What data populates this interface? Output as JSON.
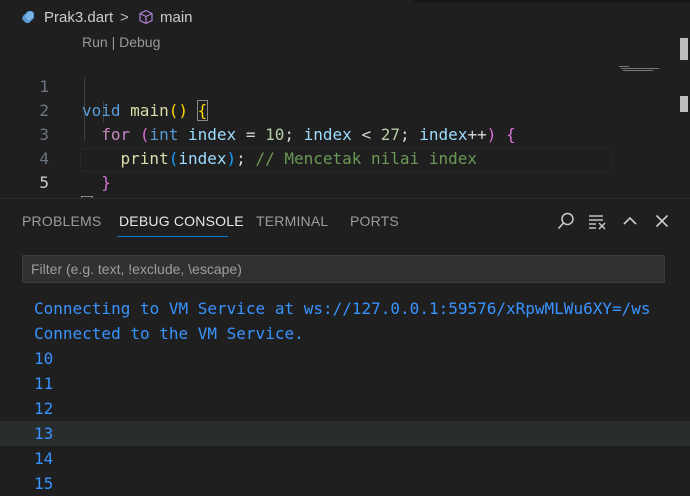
{
  "breadcrumb": {
    "file": "Prak3.dart",
    "separator": ">",
    "symbol": "main"
  },
  "editor": {
    "codelens": "Run | Debug",
    "line_numbers": [
      "1",
      "2",
      "3",
      "4",
      "5"
    ],
    "active_line": "5",
    "lines": [
      "void main() {",
      "  for (int index = 10; index < 27; index++) {",
      "    print(index); // Mencetak nilai index",
      "  }",
      "}"
    ]
  },
  "panel": {
    "tabs": [
      "PROBLEMS",
      "DEBUG CONSOLE",
      "TERMINAL",
      "PORTS"
    ],
    "active_tab": "DEBUG CONSOLE",
    "filter_placeholder": "Filter (e.g. text, !exclude, \\escape)",
    "console_lines": [
      "Connecting to VM Service at ws://127.0.0.1:59576/xRpwMLWu6XY=/ws",
      "Connected to the VM Service.",
      "10",
      "11",
      "12",
      "13",
      "14",
      "15"
    ],
    "highlighted_line": "13"
  },
  "colors": {
    "background": "#1f1f1f",
    "accent": "#0078d4",
    "console_text": "#3794ff"
  },
  "icons": [
    "dart-icon",
    "method-cube-icon",
    "search-icon",
    "filter-list-icon",
    "chevron-up-icon",
    "close-icon"
  ]
}
